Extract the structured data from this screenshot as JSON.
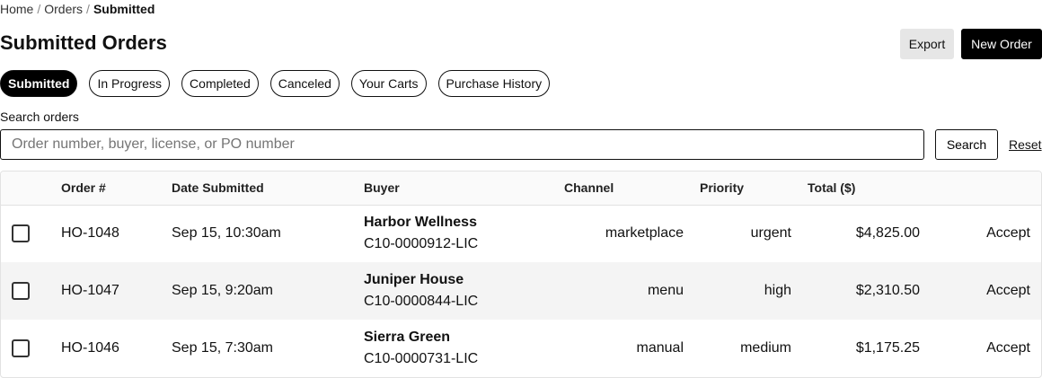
{
  "breadcrumb": {
    "home": "Home",
    "orders": "Orders",
    "current": "Submitted",
    "separator": "/"
  },
  "page": {
    "title": "Submitted Orders"
  },
  "actions": {
    "export": "Export",
    "new_order": "New Order"
  },
  "tabs": [
    {
      "label": "Submitted",
      "active": true
    },
    {
      "label": "In Progress",
      "active": false
    },
    {
      "label": "Completed",
      "active": false
    },
    {
      "label": "Canceled",
      "active": false
    },
    {
      "label": "Your Carts",
      "active": false
    },
    {
      "label": "Purchase History",
      "active": false
    }
  ],
  "search": {
    "label": "Search orders",
    "placeholder": "Order number, buyer, license, or PO number",
    "value": "",
    "button": "Search",
    "reset": "Reset"
  },
  "table": {
    "headers": [
      "Order #",
      "Date Submitted",
      "Buyer",
      "Channel",
      "Priority",
      "Total ($)"
    ],
    "rows": [
      {
        "order": "HO-1048",
        "date": "Sep 15, 10:30am",
        "buyer": "Harbor Wellness",
        "license": "C10-0000912-LIC",
        "channel": "marketplace",
        "priority": "urgent",
        "total": "$4,825.00",
        "action": "Accept",
        "checked": false
      },
      {
        "order": "HO-1047",
        "date": "Sep 15, 9:20am",
        "buyer": "Juniper House",
        "license": "C10-0000844-LIC",
        "channel": "menu",
        "priority": "high",
        "total": "$2,310.50",
        "action": "Accept",
        "checked": false
      },
      {
        "order": "HO-1046",
        "date": "Sep 15, 7:30am",
        "buyer": "Sierra Green",
        "license": "C10-0000731-LIC",
        "channel": "manual",
        "priority": "medium",
        "total": "$1,175.25",
        "action": "Accept",
        "checked": false
      }
    ]
  }
}
